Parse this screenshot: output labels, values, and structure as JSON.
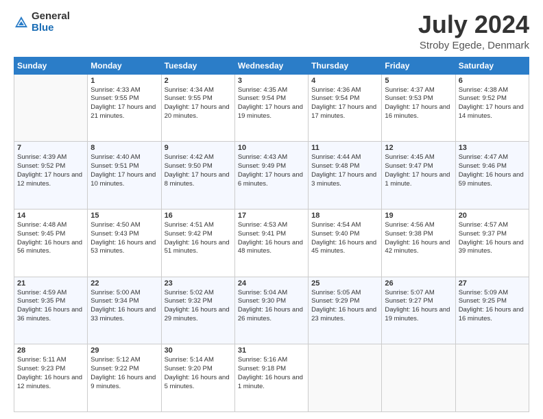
{
  "logo": {
    "general": "General",
    "blue": "Blue"
  },
  "title": {
    "month_year": "July 2024",
    "location": "Stroby Egede, Denmark"
  },
  "days_header": [
    "Sunday",
    "Monday",
    "Tuesday",
    "Wednesday",
    "Thursday",
    "Friday",
    "Saturday"
  ],
  "weeks": [
    [
      {
        "day": "",
        "sunrise": "",
        "sunset": "",
        "daylight": ""
      },
      {
        "day": "1",
        "sunrise": "Sunrise: 4:33 AM",
        "sunset": "Sunset: 9:55 PM",
        "daylight": "Daylight: 17 hours and 21 minutes."
      },
      {
        "day": "2",
        "sunrise": "Sunrise: 4:34 AM",
        "sunset": "Sunset: 9:55 PM",
        "daylight": "Daylight: 17 hours and 20 minutes."
      },
      {
        "day": "3",
        "sunrise": "Sunrise: 4:35 AM",
        "sunset": "Sunset: 9:54 PM",
        "daylight": "Daylight: 17 hours and 19 minutes."
      },
      {
        "day": "4",
        "sunrise": "Sunrise: 4:36 AM",
        "sunset": "Sunset: 9:54 PM",
        "daylight": "Daylight: 17 hours and 17 minutes."
      },
      {
        "day": "5",
        "sunrise": "Sunrise: 4:37 AM",
        "sunset": "Sunset: 9:53 PM",
        "daylight": "Daylight: 17 hours and 16 minutes."
      },
      {
        "day": "6",
        "sunrise": "Sunrise: 4:38 AM",
        "sunset": "Sunset: 9:52 PM",
        "daylight": "Daylight: 17 hours and 14 minutes."
      }
    ],
    [
      {
        "day": "7",
        "sunrise": "Sunrise: 4:39 AM",
        "sunset": "Sunset: 9:52 PM",
        "daylight": "Daylight: 17 hours and 12 minutes."
      },
      {
        "day": "8",
        "sunrise": "Sunrise: 4:40 AM",
        "sunset": "Sunset: 9:51 PM",
        "daylight": "Daylight: 17 hours and 10 minutes."
      },
      {
        "day": "9",
        "sunrise": "Sunrise: 4:42 AM",
        "sunset": "Sunset: 9:50 PM",
        "daylight": "Daylight: 17 hours and 8 minutes."
      },
      {
        "day": "10",
        "sunrise": "Sunrise: 4:43 AM",
        "sunset": "Sunset: 9:49 PM",
        "daylight": "Daylight: 17 hours and 6 minutes."
      },
      {
        "day": "11",
        "sunrise": "Sunrise: 4:44 AM",
        "sunset": "Sunset: 9:48 PM",
        "daylight": "Daylight: 17 hours and 3 minutes."
      },
      {
        "day": "12",
        "sunrise": "Sunrise: 4:45 AM",
        "sunset": "Sunset: 9:47 PM",
        "daylight": "Daylight: 17 hours and 1 minute."
      },
      {
        "day": "13",
        "sunrise": "Sunrise: 4:47 AM",
        "sunset": "Sunset: 9:46 PM",
        "daylight": "Daylight: 16 hours and 59 minutes."
      }
    ],
    [
      {
        "day": "14",
        "sunrise": "Sunrise: 4:48 AM",
        "sunset": "Sunset: 9:45 PM",
        "daylight": "Daylight: 16 hours and 56 minutes."
      },
      {
        "day": "15",
        "sunrise": "Sunrise: 4:50 AM",
        "sunset": "Sunset: 9:43 PM",
        "daylight": "Daylight: 16 hours and 53 minutes."
      },
      {
        "day": "16",
        "sunrise": "Sunrise: 4:51 AM",
        "sunset": "Sunset: 9:42 PM",
        "daylight": "Daylight: 16 hours and 51 minutes."
      },
      {
        "day": "17",
        "sunrise": "Sunrise: 4:53 AM",
        "sunset": "Sunset: 9:41 PM",
        "daylight": "Daylight: 16 hours and 48 minutes."
      },
      {
        "day": "18",
        "sunrise": "Sunrise: 4:54 AM",
        "sunset": "Sunset: 9:40 PM",
        "daylight": "Daylight: 16 hours and 45 minutes."
      },
      {
        "day": "19",
        "sunrise": "Sunrise: 4:56 AM",
        "sunset": "Sunset: 9:38 PM",
        "daylight": "Daylight: 16 hours and 42 minutes."
      },
      {
        "day": "20",
        "sunrise": "Sunrise: 4:57 AM",
        "sunset": "Sunset: 9:37 PM",
        "daylight": "Daylight: 16 hours and 39 minutes."
      }
    ],
    [
      {
        "day": "21",
        "sunrise": "Sunrise: 4:59 AM",
        "sunset": "Sunset: 9:35 PM",
        "daylight": "Daylight: 16 hours and 36 minutes."
      },
      {
        "day": "22",
        "sunrise": "Sunrise: 5:00 AM",
        "sunset": "Sunset: 9:34 PM",
        "daylight": "Daylight: 16 hours and 33 minutes."
      },
      {
        "day": "23",
        "sunrise": "Sunrise: 5:02 AM",
        "sunset": "Sunset: 9:32 PM",
        "daylight": "Daylight: 16 hours and 29 minutes."
      },
      {
        "day": "24",
        "sunrise": "Sunrise: 5:04 AM",
        "sunset": "Sunset: 9:30 PM",
        "daylight": "Daylight: 16 hours and 26 minutes."
      },
      {
        "day": "25",
        "sunrise": "Sunrise: 5:05 AM",
        "sunset": "Sunset: 9:29 PM",
        "daylight": "Daylight: 16 hours and 23 minutes."
      },
      {
        "day": "26",
        "sunrise": "Sunrise: 5:07 AM",
        "sunset": "Sunset: 9:27 PM",
        "daylight": "Daylight: 16 hours and 19 minutes."
      },
      {
        "day": "27",
        "sunrise": "Sunrise: 5:09 AM",
        "sunset": "Sunset: 9:25 PM",
        "daylight": "Daylight: 16 hours and 16 minutes."
      }
    ],
    [
      {
        "day": "28",
        "sunrise": "Sunrise: 5:11 AM",
        "sunset": "Sunset: 9:23 PM",
        "daylight": "Daylight: 16 hours and 12 minutes."
      },
      {
        "day": "29",
        "sunrise": "Sunrise: 5:12 AM",
        "sunset": "Sunset: 9:22 PM",
        "daylight": "Daylight: 16 hours and 9 minutes."
      },
      {
        "day": "30",
        "sunrise": "Sunrise: 5:14 AM",
        "sunset": "Sunset: 9:20 PM",
        "daylight": "Daylight: 16 hours and 5 minutes."
      },
      {
        "day": "31",
        "sunrise": "Sunrise: 5:16 AM",
        "sunset": "Sunset: 9:18 PM",
        "daylight": "Daylight: 16 hours and 1 minute."
      },
      {
        "day": "",
        "sunrise": "",
        "sunset": "",
        "daylight": ""
      },
      {
        "day": "",
        "sunrise": "",
        "sunset": "",
        "daylight": ""
      },
      {
        "day": "",
        "sunrise": "",
        "sunset": "",
        "daylight": ""
      }
    ]
  ]
}
